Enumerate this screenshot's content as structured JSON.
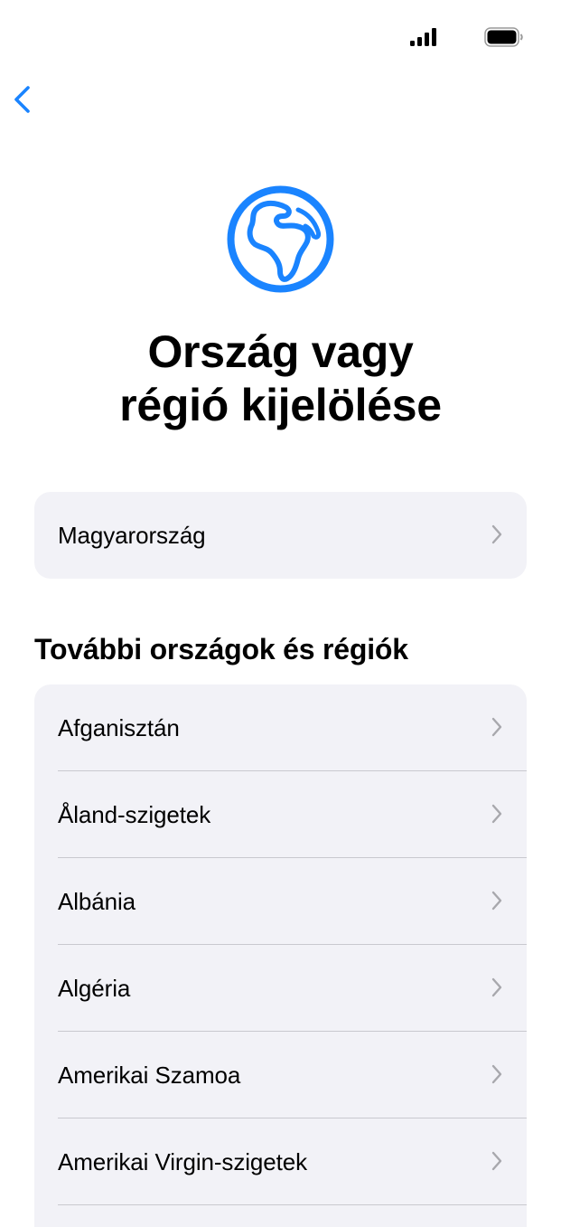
{
  "colors": {
    "accent": "#1a84ff",
    "card_bg": "#f2f2f7",
    "chevron": "#a8a8ad"
  },
  "status_bar": {
    "signal_icon": "cellular-signal-icon",
    "battery_icon": "battery-icon"
  },
  "nav": {
    "back_icon": "chevron-left-icon"
  },
  "header": {
    "icon": "globe-icon",
    "title_line1": "Ország vagy",
    "title_line2": "régió kijelölése"
  },
  "suggested": {
    "label": "Magyarország"
  },
  "more": {
    "section_title": "További országok és régiók",
    "items": [
      {
        "label": "Afganisztán"
      },
      {
        "label": "Åland-szigetek"
      },
      {
        "label": "Albánia"
      },
      {
        "label": "Algéria"
      },
      {
        "label": "Amerikai Szamoa"
      },
      {
        "label": "Amerikai Virgin-szigetek"
      }
    ]
  }
}
